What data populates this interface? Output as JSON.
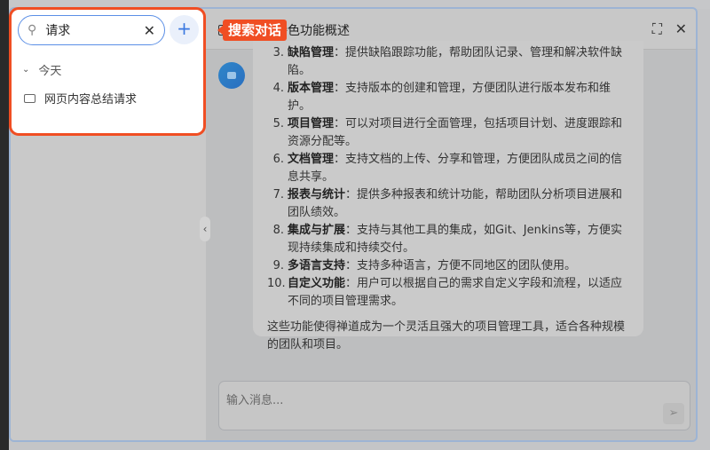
{
  "popup": {
    "search_value": "请求",
    "group_label": "今天",
    "conversations": [
      "网页内容总结请求"
    ]
  },
  "callout": "搜索对话",
  "header": {
    "title": "理软件特色功能概述"
  },
  "message": {
    "items": [
      {
        "n": "3.",
        "term": "缺陷管理",
        "desc": "：提供缺陷跟踪功能，帮助团队记录、管理和解决软件缺陷。"
      },
      {
        "n": "4.",
        "term": "版本管理",
        "desc": "：支持版本的创建和管理，方便团队进行版本发布和维护。"
      },
      {
        "n": "5.",
        "term": "项目管理",
        "desc": "：可以对项目进行全面管理，包括项目计划、进度跟踪和资源分配等。"
      },
      {
        "n": "6.",
        "term": "文档管理",
        "desc": "：支持文档的上传、分享和管理，方便团队成员之间的信息共享。"
      },
      {
        "n": "7.",
        "term": "报表与统计",
        "desc": "：提供多种报表和统计功能，帮助团队分析项目进展和团队绩效。"
      },
      {
        "n": "8.",
        "term": "集成与扩展",
        "desc": "：支持与其他工具的集成，如Git、Jenkins等，方便实现持续集成和持续交付。"
      },
      {
        "n": "9.",
        "term": "多语言支持",
        "desc": "：支持多种语言，方便不同地区的团队使用。"
      },
      {
        "n": "10.",
        "term": "自定义功能",
        "desc": "：用户可以根据自己的需求自定义字段和流程，以适应不同的项目管理需求。"
      }
    ],
    "summary": "这些功能使得禅道成为一个灵活且强大的项目管理工具，适合各种规模的团队和项目。"
  },
  "input": {
    "placeholder": "输入消息..."
  }
}
